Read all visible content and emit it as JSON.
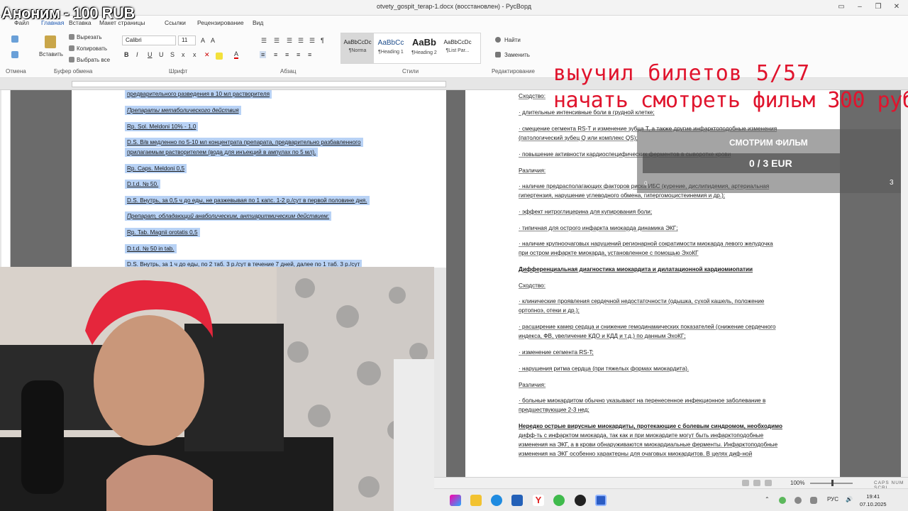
{
  "window": {
    "title": "otvety_gospit_terap-1.docx (восстановлен) - РусВорд"
  },
  "ribbon": {
    "tabs": [
      "Файл",
      "Главная",
      "Вставка",
      "Макет страницы",
      "Ссылки",
      "Рецензирование",
      "Вид"
    ],
    "clipboard": {
      "paste": "Вставить",
      "cut": "Вырезать",
      "copy": "Копировать",
      "select_all": "Выбрать все",
      "label": "Буфер обмена"
    },
    "undo_label": "Отмена",
    "font": {
      "name": "Calibri",
      "size": "11",
      "label": "Шрифт"
    },
    "paragraph_label": "Абзац",
    "styles": {
      "label": "Стили",
      "items": [
        {
          "sample": "AaBbCcDc",
          "name": "¶Norma"
        },
        {
          "sample": "AaBbCc",
          "name": "¶Heading 1"
        },
        {
          "sample": "AaBb",
          "name": "¶Heading 2"
        },
        {
          "sample": "AaBbCcDc",
          "name": "¶List Par..."
        }
      ]
    },
    "editing": {
      "find": "Найти",
      "replace": "Заменить",
      "label": "Редактирование"
    }
  },
  "page1": {
    "lines": [
      {
        "text": "предварительного разведения в 10 мл растворителя",
        "style": "sel"
      },
      {
        "text": "Препараты метаболического действия",
        "style": "sel-it"
      },
      {
        "text": "Rp. Sol. Meldoni 10% - 1,0",
        "style": "sel"
      },
      {
        "text": "D.S. В/в медленно по 5-10 мл концентрата препарата, предварительно разбавленного",
        "style": "sel"
      },
      {
        "text": "прилагаемым растворителем (вода для инъекций в ампулах по 5 мл).",
        "style": "sel"
      },
      {
        "text": "Rp. Caps. Meldoni 0,5",
        "style": "sel"
      },
      {
        "text": "D.t.d. № 50.",
        "style": "sel"
      },
      {
        "text": "D.S. Внутрь, за 0,5 ч до еды, не разжевывая по 1 капс. 1-2 р./сут в первой половине дня.",
        "style": "sel"
      },
      {
        "text": "Препарат, обладающий анаболическим, антиаритмическим действием:",
        "style": "sel-it"
      },
      {
        "text": "Rp. Tab. Magnii orotatis 0,5",
        "style": "sel"
      },
      {
        "text": "D.t.d. № 50 in tab.",
        "style": "sel"
      },
      {
        "text": "D.S. Внутрь, за 1 ч до еды, по 2 таб. 3 р./сут в течение 7 дней, далее по 1 таб. 3 р./сут",
        "style": "sel"
      }
    ]
  },
  "page2": {
    "lines": [
      {
        "text": "Сходство:",
        "style": "n"
      },
      {
        "text": "· длительные интенсивные боли в грудной клетке;",
        "style": "n"
      },
      {
        "text": "· смещение сегмента RS-T и изменение зубца T, а также другие инфарктоподобные изменения",
        "style": "n"
      },
      {
        "text": "(патологический зубец Q или комплекс QS);",
        "style": "n"
      },
      {
        "text": "· повышение активности кардиоспецифических ферментов в сыворотке крови",
        "style": "n"
      },
      {
        "text": "Различия:",
        "style": "n"
      },
      {
        "text": "· наличие предрасполагающих факторов риска ИБС (курение, дислипидемия, артериальная",
        "style": "n"
      },
      {
        "text": "гипертензия, нарушение углеводного обмена, гипергомоцистеинемия и др.);",
        "style": "n"
      },
      {
        "text": "· эффект нитроглицерина для купирования боли;",
        "style": "n"
      },
      {
        "text": "· типичная для острого инфаркта миокарда динамика ЭКГ;",
        "style": "n"
      },
      {
        "text": "· наличие крупноочаговых нарушений регионарной сократимости миокарда левого желудочка",
        "style": "n"
      },
      {
        "text": "при остром инфаркте миокарда, установленное с помощью ЭхоКГ",
        "style": "n"
      },
      {
        "text": "Дифференциальная диагностика миокардита и дилатационной кардиомиопатии",
        "style": "b"
      },
      {
        "text": "Сходство:",
        "style": "n"
      },
      {
        "text": "· клинические проявления сердечной недостаточности (одышка, сухой кашель, положение",
        "style": "n"
      },
      {
        "text": "ортопноэ, отеки и др.);",
        "style": "n"
      },
      {
        "text": "· расширение камер сердца и снижение гемодинамических показателей (снижение сердечного",
        "style": "n"
      },
      {
        "text": "индекса, ФВ, увеличение КДО и КДД и т.д.) по данным ЭхоКГ;",
        "style": "n"
      },
      {
        "text": "· изменение сегмента RS-T;",
        "style": "n"
      },
      {
        "text": "· нарушения ритма сердца (при тяжелых формах миокардита).",
        "style": "n"
      },
      {
        "text": "Различия:",
        "style": "n"
      },
      {
        "text": "· больные миокардитом обычно указывают на перенесенное инфекционное заболевание в",
        "style": "n"
      },
      {
        "text": "предшествующие 2-3 нед;",
        "style": "n"
      },
      {
        "text": "Нередко острые вирусные миокардиты, протекающие с болевым синдромом, необходимо",
        "style": "b"
      },
      {
        "text": "дифф-ть с инфарктом миокарда, так как и при миокардите могут быть инфарктоподобные",
        "style": "mix"
      },
      {
        "text": "изменения на ЭКГ, а в крови обнаруживаются миокардиальные ферменты. Инфарктоподобные",
        "style": "n"
      },
      {
        "text": "изменения на ЭКГ особенно характерны для очаговых миокардитов. В целях диф-ной",
        "style": "n"
      }
    ]
  },
  "statusbar": {
    "zoom": "100%",
    "caps": "CAPS NUM SCRL"
  },
  "taskbar": {
    "lang": "РУС",
    "time": "19:41",
    "date": "07.10.2025"
  },
  "overlay": {
    "donor": "Аноним - 100 RUB",
    "tickets": "выучил билетов 5/57",
    "movie_goal": "начать смотреть фильм 300 руб",
    "watch_title": "СМОТРИМ ФИЛЬМ",
    "watch_amount": "0 / 3 EUR",
    "watch_min": "0",
    "watch_max": "3",
    "watch_progress": 0
  },
  "colors": {
    "selection": "#b8d2f5",
    "accent": "#1a56b0",
    "overlay_red": "#e0142d"
  }
}
